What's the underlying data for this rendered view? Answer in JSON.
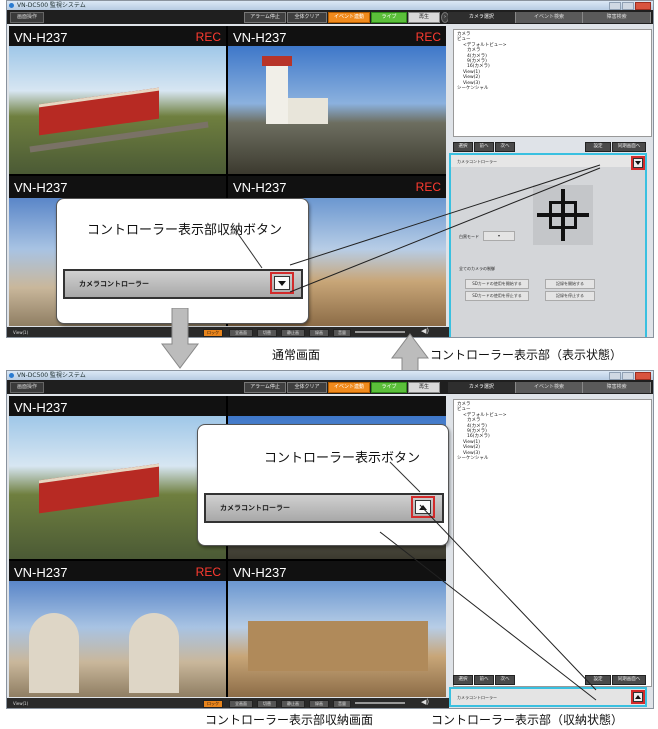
{
  "window": {
    "title": "VN-DC500 監視システム",
    "menu_left": "画面操作"
  },
  "toolbar": {
    "alarm_stop": "アラーム停止",
    "all_clear": "全体クリア",
    "event_link": "イベント連動",
    "live": "ライブ",
    "play": "再生"
  },
  "tabs": [
    "カメラ選択",
    "イベント検索",
    "障害検索"
  ],
  "tree": [
    "カメラ",
    "ビュー",
    "<デフォルトビュー>",
    "カメラ",
    "4(カメラ)",
    "9(カメラ)",
    "16(カメラ)",
    "View(1)",
    "View(2)",
    "View(3)",
    "シーケンシャル"
  ],
  "panel_buttons": {
    "select": "選択",
    "prev": "前へ",
    "next": "次へ",
    "settings": "設定",
    "sync": "同期画面へ"
  },
  "cameras": [
    {
      "label": "VN-H237",
      "rec": "REC"
    },
    {
      "label": "VN-H237",
      "rec": "REC"
    },
    {
      "label": "VN-H237",
      "rec": "REC"
    },
    {
      "label": "VN-H237",
      "rec": "REC"
    }
  ],
  "statusbar": {
    "view": "View(1)",
    "lock": "ロック",
    "fullscreen": "全画面",
    "cut": "切替",
    "still": "静止画",
    "record": "録画",
    "volume": "音量"
  },
  "controller": {
    "title": "カメラコントローラー",
    "mode_label": "白黒モード",
    "all_cameras": "全てのカメラの制御",
    "sd_start": "SDカードの使用を開始する",
    "sd_stop": "SDカードの使用を停止する",
    "rec_start": "記録を開始する",
    "rec_stop": "記録を停止する"
  },
  "callouts": {
    "collapse_button": "コントローラー表示部収納ボタン",
    "show_button": "コントローラー表示ボタン",
    "bar_label": "カメラコントローラー"
  },
  "captions": {
    "normal_screen": "通常画面",
    "controller_shown": "コントローラー表示部（表示状態）",
    "collapsed_screen": "コントローラー表示部収納画面",
    "controller_collapsed": "コントローラー表示部（収納状態）"
  },
  "colors": {
    "rec_red": "#ff3b30",
    "highlight_red": "#d22b2b",
    "panel_cyan": "#39c0e0",
    "event_orange": "#f08a1c",
    "live_green": "#5bbf3a"
  }
}
